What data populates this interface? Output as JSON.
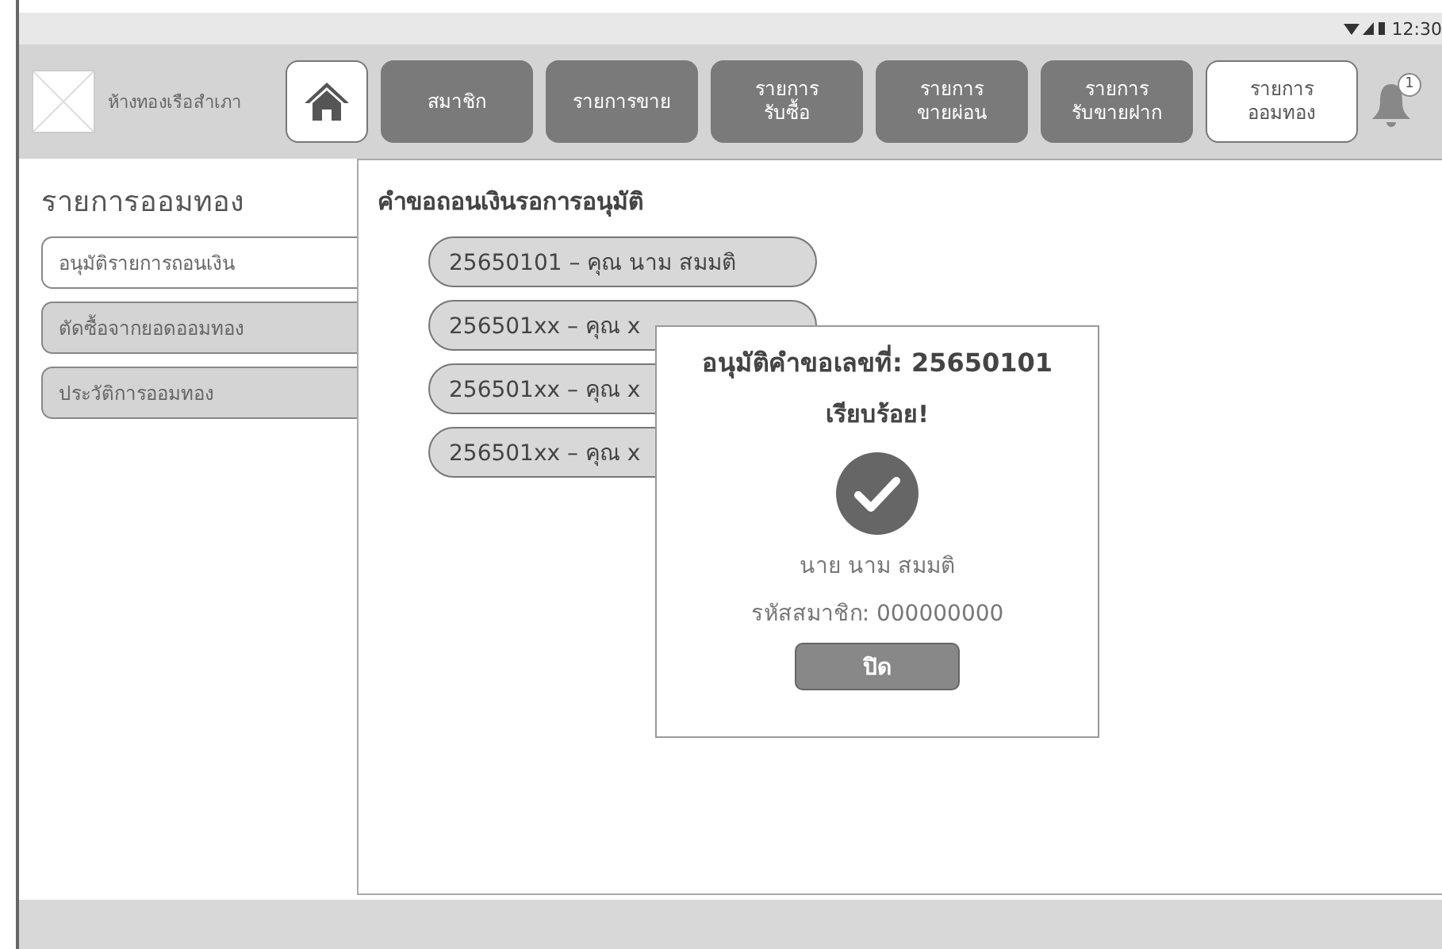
{
  "status_bar": {
    "time": "12:30"
  },
  "header": {
    "shop_name": "ห้างทองเรือสำเภา",
    "nav": [
      {
        "label": "สมาชิก",
        "selected": false
      },
      {
        "label": "รายการขาย",
        "selected": false
      },
      {
        "label": "รายการ\nรับซื้อ",
        "selected": false
      },
      {
        "label": "รายการ\nขายผ่อน",
        "selected": false
      },
      {
        "label": "รายการ\nรับขายฝาก",
        "selected": false
      },
      {
        "label": "รายการ\nออมทอง",
        "selected": true
      }
    ],
    "notification_count": "1"
  },
  "sidebar": {
    "title": "รายการออมทอง",
    "items": [
      {
        "label": "อนุมัติรายการถอนเงิน",
        "selected": true
      },
      {
        "label": "ตัดซื้อจากยอดออมทอง",
        "selected": false
      },
      {
        "label": "ประวัติการออมทอง",
        "selected": false
      }
    ]
  },
  "main": {
    "title": "คำขอถอนเงินรอการอนุมัติ",
    "requests": [
      "25650101 – คุณ นาม สมมติ",
      "256501xx – คุณ x",
      "256501xx – คุณ x",
      "256501xx – คุณ x"
    ]
  },
  "dialog": {
    "title": "อนุมัติคำขอเลขที่: 25650101",
    "message": "เรียบร้อย!",
    "name": "นาย นาม สมมติ",
    "member_id": "รหัสสมาชิก: 000000000",
    "button": "ปิด"
  }
}
